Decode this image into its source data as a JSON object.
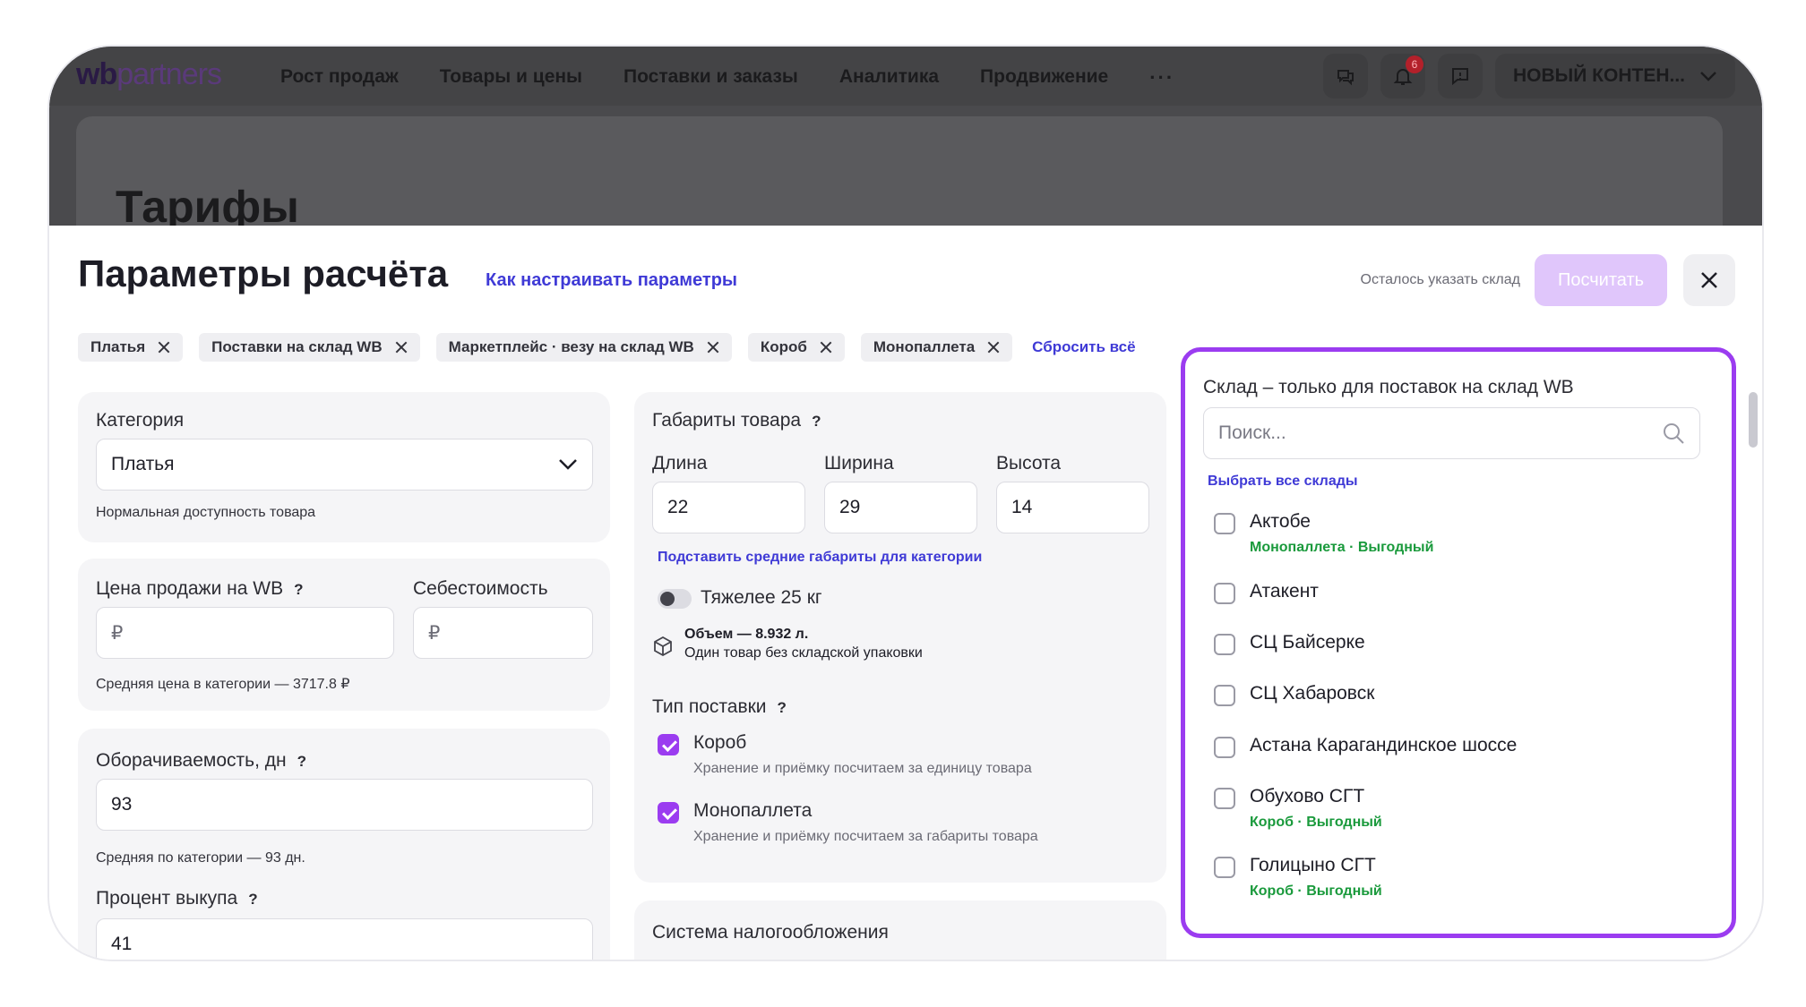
{
  "header": {
    "logo_wb": "wb",
    "logo_rest": "partners",
    "nav": [
      "Рост продаж",
      "Товары и цены",
      "Поставки и заказы",
      "Аналитика",
      "Продвижение"
    ],
    "more": "···",
    "badge_count": "6",
    "account": "НОВЫЙ КОНТЕН..."
  },
  "background": {
    "page_title": "Тарифы"
  },
  "modal": {
    "title": "Параметры расчёта",
    "help_link": "Как настраивать параметры",
    "hint": "Осталось указать склад",
    "calc_button": "Посчитать",
    "chips": [
      "Платья",
      "Поставки на склад WB",
      "Маркетплейс · везу на склад WB",
      "Короб",
      "Монопаллета"
    ],
    "reset": "Сбросить всё"
  },
  "category": {
    "label": "Категория",
    "value": "Платья",
    "note": "Нормальная доступность товара"
  },
  "price": {
    "label": "Цена продажи на WB",
    "q": "?",
    "cost_label": "Себестоимость",
    "currency": "₽",
    "note": "Средняя цена в категории — 3717.8 ₽"
  },
  "turnover": {
    "label": "Оборачиваемость, дн",
    "q": "?",
    "value": "93",
    "note": "Средняя по категории — 93 дн."
  },
  "buyout": {
    "label": "Процент выкупа",
    "q": "?",
    "value": "41"
  },
  "dimensions": {
    "label": "Габариты товара",
    "q": "?",
    "length_label": "Длина",
    "width_label": "Ширина",
    "height_label": "Высота",
    "length": "22",
    "width": "29",
    "height": "14",
    "avg_link": "Подставить средние габариты для категории",
    "heavy_label": "Тяжелее 25 кг",
    "volume": "Объем — 8.932 л.",
    "volume_note": "Один товар без складской упаковки"
  },
  "supply_type": {
    "label": "Тип поставки",
    "q": "?",
    "options": [
      {
        "name": "Короб",
        "desc": "Хранение и приёмку посчитаем за единицу товара"
      },
      {
        "name": "Монопаллета",
        "desc": "Хранение и приёмку посчитаем за габариты товара"
      }
    ]
  },
  "tax": {
    "label": "Система налогообложения"
  },
  "warehouse": {
    "title": "Склад – только для поставок на склад WB",
    "search_placeholder": "Поиск...",
    "select_all": "Выбрать все склады",
    "items": [
      {
        "name": "Актобе",
        "tag": "Монопаллета · Выгодный"
      },
      {
        "name": "Атакент",
        "tag": ""
      },
      {
        "name": "СЦ Байсерке",
        "tag": ""
      },
      {
        "name": "СЦ Хабаровск",
        "tag": ""
      },
      {
        "name": "Астана Карагандинское шоссе",
        "tag": ""
      },
      {
        "name": "Обухово СГТ",
        "tag": "Короб · Выгодный"
      },
      {
        "name": "Голицыно СГТ",
        "tag": "Короб · Выгодный"
      }
    ]
  },
  "colors": {
    "accent": "#9b3cf0",
    "link": "#3f3ad6",
    "good": "#1a9a3c"
  }
}
